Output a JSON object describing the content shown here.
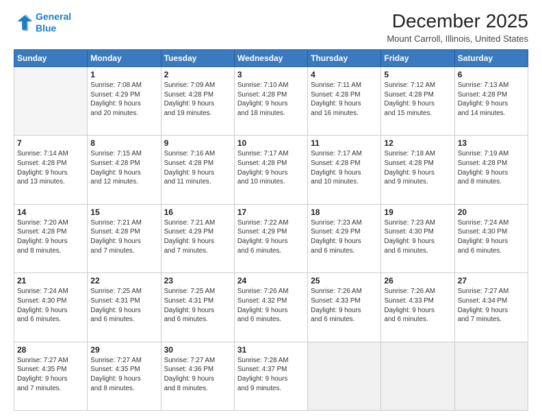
{
  "logo": {
    "line1": "General",
    "line2": "Blue"
  },
  "title": "December 2025",
  "subtitle": "Mount Carroll, Illinois, United States",
  "header_days": [
    "Sunday",
    "Monday",
    "Tuesday",
    "Wednesday",
    "Thursday",
    "Friday",
    "Saturday"
  ],
  "weeks": [
    [
      {
        "num": "",
        "info": ""
      },
      {
        "num": "1",
        "info": "Sunrise: 7:08 AM\nSunset: 4:29 PM\nDaylight: 9 hours\nand 20 minutes."
      },
      {
        "num": "2",
        "info": "Sunrise: 7:09 AM\nSunset: 4:28 PM\nDaylight: 9 hours\nand 19 minutes."
      },
      {
        "num": "3",
        "info": "Sunrise: 7:10 AM\nSunset: 4:28 PM\nDaylight: 9 hours\nand 18 minutes."
      },
      {
        "num": "4",
        "info": "Sunrise: 7:11 AM\nSunset: 4:28 PM\nDaylight: 9 hours\nand 16 minutes."
      },
      {
        "num": "5",
        "info": "Sunrise: 7:12 AM\nSunset: 4:28 PM\nDaylight: 9 hours\nand 15 minutes."
      },
      {
        "num": "6",
        "info": "Sunrise: 7:13 AM\nSunset: 4:28 PM\nDaylight: 9 hours\nand 14 minutes."
      }
    ],
    [
      {
        "num": "7",
        "info": "Sunrise: 7:14 AM\nSunset: 4:28 PM\nDaylight: 9 hours\nand 13 minutes."
      },
      {
        "num": "8",
        "info": "Sunrise: 7:15 AM\nSunset: 4:28 PM\nDaylight: 9 hours\nand 12 minutes."
      },
      {
        "num": "9",
        "info": "Sunrise: 7:16 AM\nSunset: 4:28 PM\nDaylight: 9 hours\nand 11 minutes."
      },
      {
        "num": "10",
        "info": "Sunrise: 7:17 AM\nSunset: 4:28 PM\nDaylight: 9 hours\nand 10 minutes."
      },
      {
        "num": "11",
        "info": "Sunrise: 7:17 AM\nSunset: 4:28 PM\nDaylight: 9 hours\nand 10 minutes."
      },
      {
        "num": "12",
        "info": "Sunrise: 7:18 AM\nSunset: 4:28 PM\nDaylight: 9 hours\nand 9 minutes."
      },
      {
        "num": "13",
        "info": "Sunrise: 7:19 AM\nSunset: 4:28 PM\nDaylight: 9 hours\nand 8 minutes."
      }
    ],
    [
      {
        "num": "14",
        "info": "Sunrise: 7:20 AM\nSunset: 4:28 PM\nDaylight: 9 hours\nand 8 minutes."
      },
      {
        "num": "15",
        "info": "Sunrise: 7:21 AM\nSunset: 4:28 PM\nDaylight: 9 hours\nand 7 minutes."
      },
      {
        "num": "16",
        "info": "Sunrise: 7:21 AM\nSunset: 4:29 PM\nDaylight: 9 hours\nand 7 minutes."
      },
      {
        "num": "17",
        "info": "Sunrise: 7:22 AM\nSunset: 4:29 PM\nDaylight: 9 hours\nand 6 minutes."
      },
      {
        "num": "18",
        "info": "Sunrise: 7:23 AM\nSunset: 4:29 PM\nDaylight: 9 hours\nand 6 minutes."
      },
      {
        "num": "19",
        "info": "Sunrise: 7:23 AM\nSunset: 4:30 PM\nDaylight: 9 hours\nand 6 minutes."
      },
      {
        "num": "20",
        "info": "Sunrise: 7:24 AM\nSunset: 4:30 PM\nDaylight: 9 hours\nand 6 minutes."
      }
    ],
    [
      {
        "num": "21",
        "info": "Sunrise: 7:24 AM\nSunset: 4:30 PM\nDaylight: 9 hours\nand 6 minutes."
      },
      {
        "num": "22",
        "info": "Sunrise: 7:25 AM\nSunset: 4:31 PM\nDaylight: 9 hours\nand 6 minutes."
      },
      {
        "num": "23",
        "info": "Sunrise: 7:25 AM\nSunset: 4:31 PM\nDaylight: 9 hours\nand 6 minutes."
      },
      {
        "num": "24",
        "info": "Sunrise: 7:26 AM\nSunset: 4:32 PM\nDaylight: 9 hours\nand 6 minutes."
      },
      {
        "num": "25",
        "info": "Sunrise: 7:26 AM\nSunset: 4:33 PM\nDaylight: 9 hours\nand 6 minutes."
      },
      {
        "num": "26",
        "info": "Sunrise: 7:26 AM\nSunset: 4:33 PM\nDaylight: 9 hours\nand 6 minutes."
      },
      {
        "num": "27",
        "info": "Sunrise: 7:27 AM\nSunset: 4:34 PM\nDaylight: 9 hours\nand 7 minutes."
      }
    ],
    [
      {
        "num": "28",
        "info": "Sunrise: 7:27 AM\nSunset: 4:35 PM\nDaylight: 9 hours\nand 7 minutes."
      },
      {
        "num": "29",
        "info": "Sunrise: 7:27 AM\nSunset: 4:35 PM\nDaylight: 9 hours\nand 8 minutes."
      },
      {
        "num": "30",
        "info": "Sunrise: 7:27 AM\nSunset: 4:36 PM\nDaylight: 9 hours\nand 8 minutes."
      },
      {
        "num": "31",
        "info": "Sunrise: 7:28 AM\nSunset: 4:37 PM\nDaylight: 9 hours\nand 9 minutes."
      },
      {
        "num": "",
        "info": ""
      },
      {
        "num": "",
        "info": ""
      },
      {
        "num": "",
        "info": ""
      }
    ]
  ]
}
